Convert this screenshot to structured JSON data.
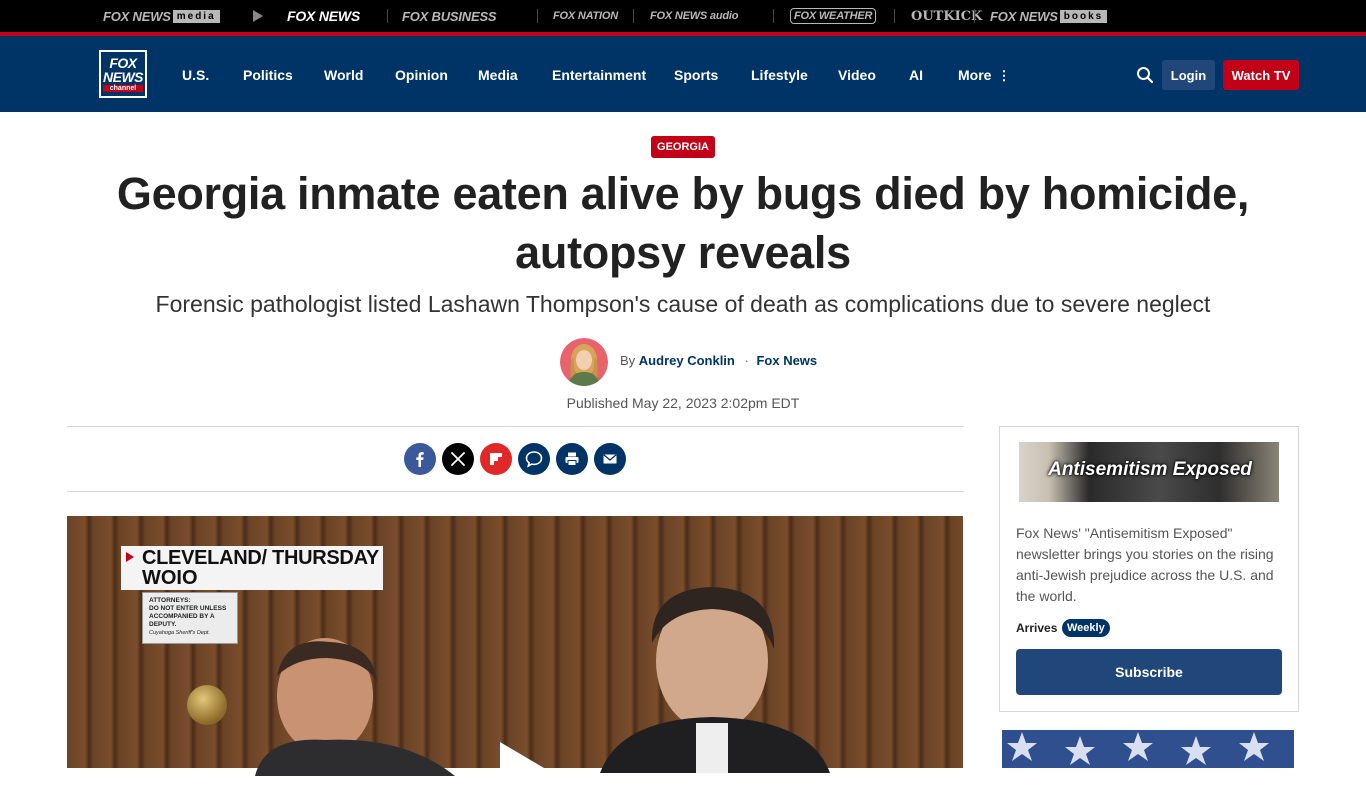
{
  "brand_bar": {
    "brands": [
      {
        "name": "FOX NEWS",
        "suffix": "media",
        "active": false
      },
      {
        "name": "FOX NEWS",
        "suffix": "",
        "active": true
      },
      {
        "name": "FOX BUSINESS",
        "suffix": "",
        "active": false
      },
      {
        "name": "FOX NATION",
        "suffix": "",
        "active": false
      },
      {
        "name": "FOX NEWS audio",
        "suffix": "",
        "active": false
      },
      {
        "name": "FOX WEATHER",
        "suffix": "",
        "active": false
      },
      {
        "name": "OUTKICK",
        "suffix": "",
        "active": false
      },
      {
        "name": "FOX NEWS",
        "suffix": "books",
        "active": false
      }
    ]
  },
  "nav": {
    "logo": {
      "line1": "FOX",
      "line2": "NEWS",
      "line3": "channel"
    },
    "items": [
      "U.S.",
      "Politics",
      "World",
      "Opinion",
      "Media",
      "Entertainment",
      "Sports",
      "Lifestyle",
      "Video",
      "AI",
      "More"
    ],
    "search_icon": "search-icon",
    "login_label": "Login",
    "watch_label": "Watch TV"
  },
  "article": {
    "eyebrow": "GEORGIA",
    "headline": "Georgia inmate eaten alive by bugs died by homicide, autopsy reveals",
    "subhead": "Forensic pathologist listed Lashawn Thompson's cause of death as complications due to severe neglect",
    "byline_prefix": "By",
    "author": "Audrey Conklin",
    "outlet": "Fox News",
    "published": "Published May 22, 2023 2:02pm EDT"
  },
  "share": [
    {
      "name": "facebook-icon",
      "color": "#3b5998"
    },
    {
      "name": "x-icon",
      "color": "#000000"
    },
    {
      "name": "flipboard-icon",
      "color": "#e12828"
    },
    {
      "name": "comments-icon",
      "color": "#003366"
    },
    {
      "name": "print-icon",
      "color": "#003366"
    },
    {
      "name": "email-icon",
      "color": "#003366"
    }
  ],
  "video": {
    "chyron_line1": "CLEVELAND/ THURSDAY",
    "chyron_line2": "WOIO",
    "door_sign_line1": "ATTORNEYS:",
    "door_sign_line2": "DO NOT ENTER UNLESS",
    "door_sign_line3": "ACCOMPANIED BY A DEPUTY.",
    "door_sign_line4": "Cuyahoga Sheriff's Dept."
  },
  "newsletter": {
    "banner_title": "Antisemitism Exposed",
    "description": "Fox News' \"Antisemitism Exposed\" newsletter brings you stories on the rising anti-Jewish prejudice across the U.S. and the world.",
    "arrives_label": "Arrives",
    "frequency": "Weekly",
    "subscribe_label": "Subscribe"
  },
  "colors": {
    "navy": "#003366",
    "red": "#c20017",
    "button_blue": "#21467a"
  }
}
